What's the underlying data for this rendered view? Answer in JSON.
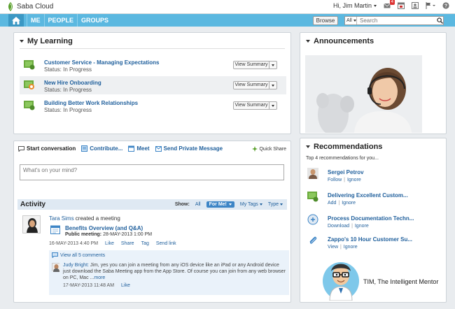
{
  "header": {
    "brand": "Saba Cloud",
    "greeting": "Hi, Jim Martin",
    "mail_count": "4"
  },
  "nav": {
    "items": [
      "ME",
      "PEOPLE",
      "GROUPS"
    ],
    "browse": "Browse",
    "search_scope": "All",
    "search_placeholder": "Search"
  },
  "learning": {
    "title": "My Learning",
    "items": [
      {
        "title": "Customer Service - Managing Expectations",
        "status": "Status: In Progress",
        "action": "View Summary"
      },
      {
        "title": "New Hire Onboarding",
        "status": "Status: In Progress",
        "action": "View Summary"
      },
      {
        "title": "Building Better Work Relationships",
        "status": "Status: In Progress",
        "action": "View Summary"
      }
    ]
  },
  "announcements": {
    "title": "Announcements"
  },
  "conversation": {
    "tabs": [
      "Start conversation",
      "Contribute...",
      "Meet",
      "Send Private Message"
    ],
    "quick_share": "Quick Share",
    "placeholder": "What's on your mind?"
  },
  "activity": {
    "title": "Activity",
    "show_label": "Show:",
    "filter_all": "All",
    "filter_forme": "For Me!",
    "filter_mytags": "My Tags",
    "filter_type": "Type",
    "post": {
      "author": "Tara Sims",
      "action": " created a meeting",
      "meeting_title": "Benefits Overview (and Q&A)",
      "meeting_label": "Public meeting:",
      "meeting_date": "28-MAY-2013 1:00 PM",
      "timestamp": "16-MAY-2013 4:40 PM",
      "actions": [
        "Like",
        "Share",
        "Tag",
        "Send link"
      ],
      "view_all": "View all 5 comments",
      "comment": {
        "author": "Judy Bright:",
        "text": " Jim, yes you can join a meeting from any iOS device like an iPad or any Android device just download the Saba Meeting app from the App Store. Of course you can join from any web browser on PC, Mac ...",
        "more": "more",
        "timestamp": "17-MAY-2013 11:48 AM",
        "like": "Like"
      }
    }
  },
  "recommendations": {
    "title": "Recommendations",
    "subtitle": "Top 4 recommendations for you...",
    "items": [
      {
        "title": "Sergei Petrov",
        "primary": "Follow",
        "secondary": "Ignore"
      },
      {
        "title": "Delivering Excellent Custom...",
        "primary": "Add",
        "secondary": "Ignore"
      },
      {
        "title": "Process Documentation Techn...",
        "primary": "Download",
        "secondary": "Ignore"
      },
      {
        "title": "Zappo's 10 Hour Customer Su...",
        "primary": "View",
        "secondary": "Ignore"
      }
    ],
    "mentor": "TIM, The Intelligent Mentor"
  },
  "colors": {
    "nav_bg": "#5bb8e0",
    "link": "#1f5f9c",
    "accent_button": "#3d85c6"
  }
}
